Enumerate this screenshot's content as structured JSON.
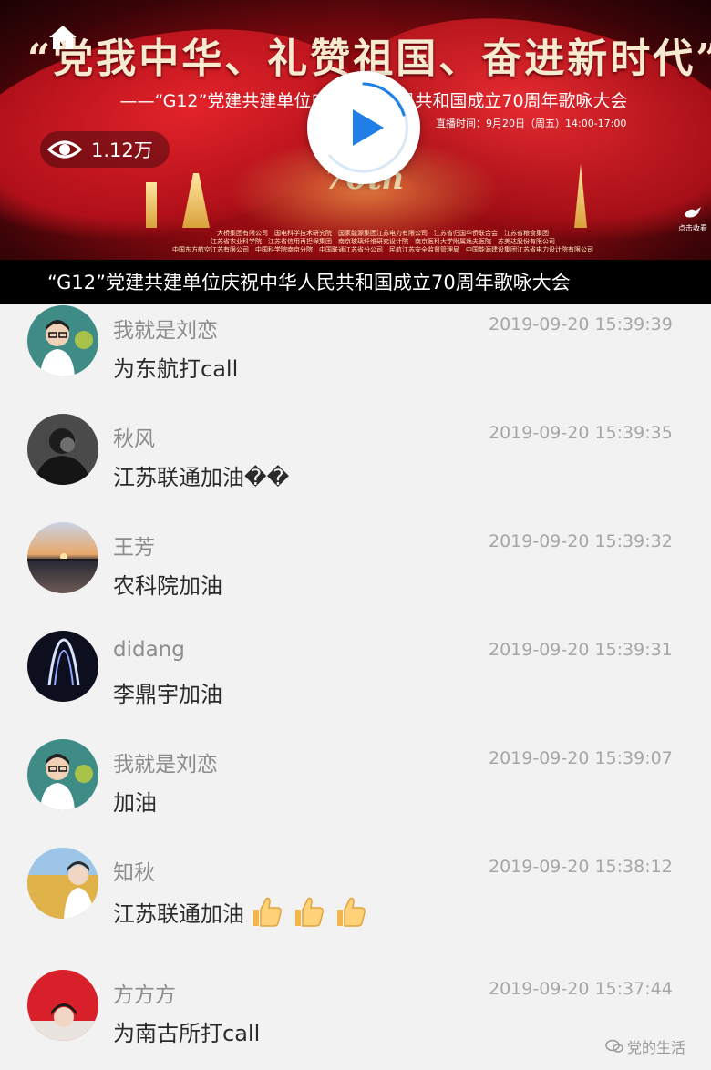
{
  "banner": {
    "title": "“党我中华、礼赞祖国、奋进新时代”",
    "subtitle": "——“G12”党建共建单位庆祝中华人民共和国成立70周年歌咏大会",
    "time": "直播时间：9月20日（周五）14:00-17:00",
    "view_count": "1.12万",
    "seventy_text": "70th",
    "sponsor_lines": [
      "大桥集团有限公司　国电科学技术研究院　国家能源集团江苏电力有限公司　江苏省归国华侨联合会　江苏省粮食集团",
      "江苏省农业科学院　江苏省信用再担保集团　南京玻璃纤维研究设计院　南京医科大学附属逸夫医院　苏美达股份有限公司",
      "中国东方航空江苏有限公司　中国科学院南京分院　中国联通江苏省分公司　民航江苏安全监督管理局　中国能源建设集团江苏省电力设计院有限公司"
    ],
    "corner_label": "点击收看",
    "caption": "“G12”党建共建单位庆祝中华人民共和国成立70周年歌咏大会"
  },
  "comments": [
    {
      "user": "我就是刘恋",
      "time": "2019-09-20 15:39:39",
      "message": "为东航打call",
      "emoji_count": 0
    },
    {
      "user": "秋风",
      "time": "2019-09-20 15:39:35",
      "message": "江苏联通加油��",
      "emoji_count": 0
    },
    {
      "user": "王芳",
      "time": "2019-09-20 15:39:32",
      "message": "农科院加油",
      "emoji_count": 0
    },
    {
      "user": "didang",
      "time": "2019-09-20 15:39:31",
      "message": "李鼎宇加油",
      "emoji_count": 0
    },
    {
      "user": "我就是刘恋",
      "time": "2019-09-20 15:39:07",
      "message": "加油",
      "emoji_count": 0
    },
    {
      "user": "知秋",
      "time": "2019-09-20 15:38:12",
      "message": "江苏联通加油",
      "emoji_count": 3
    },
    {
      "user": "方方方",
      "time": "2019-09-20 15:37:44",
      "message": "为南古所打call",
      "emoji_count": 0
    }
  ],
  "watermark": "党的生活",
  "icons": {
    "home": "home-icon",
    "views": "eye-icon",
    "play": "play-icon",
    "thumb": "thumbs-up-icon",
    "watermark": "wechat-icon"
  },
  "colors": {
    "banner_red": "#c4121a",
    "play_blue": "#1f7fe6",
    "username_gray": "#8c8c8c",
    "timestamp_gray": "#a6a6a6",
    "message_text": "#2b2b2b",
    "background": "#f2f2f2"
  }
}
